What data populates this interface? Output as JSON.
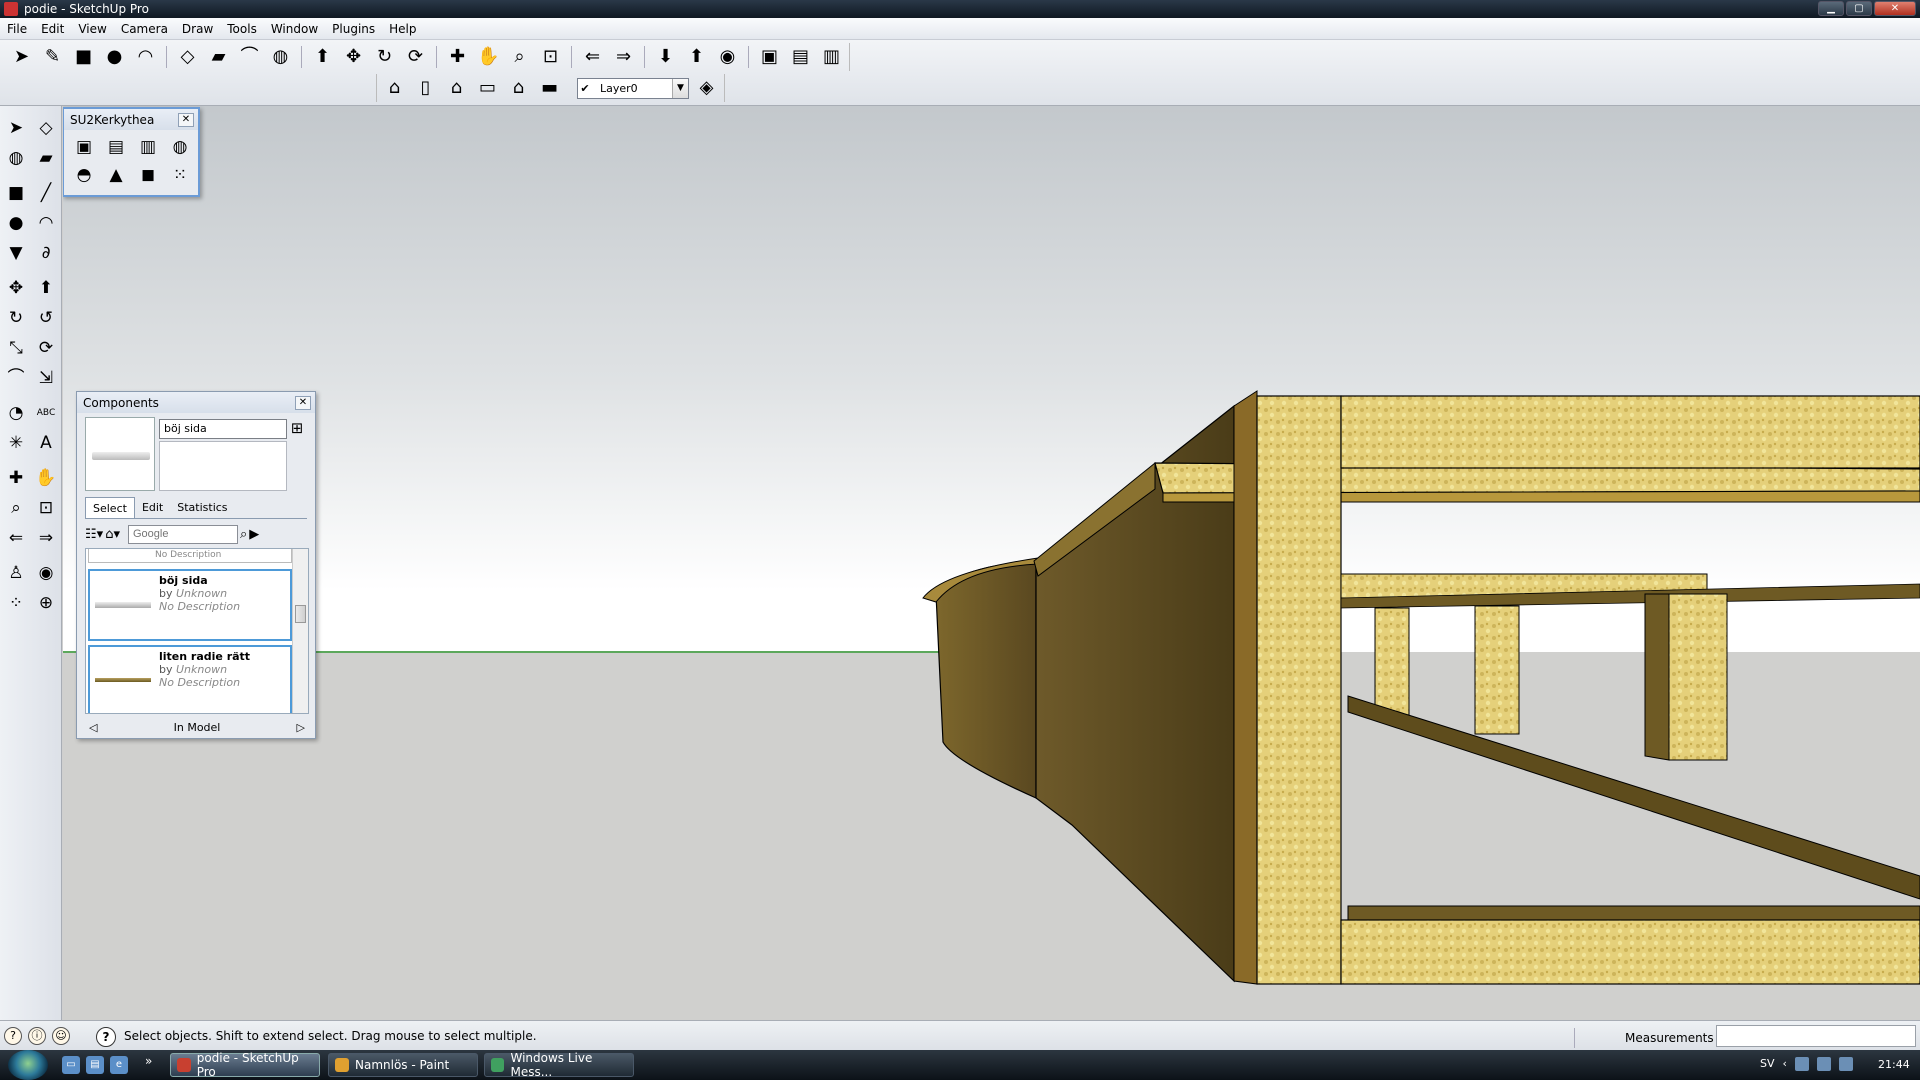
{
  "window": {
    "title": "podie - SketchUp Pro",
    "controls": [
      "minimize",
      "maximize",
      "close"
    ]
  },
  "menu": [
    "File",
    "Edit",
    "View",
    "Camera",
    "Draw",
    "Tools",
    "Window",
    "Plugins",
    "Help"
  ],
  "toolbar1": {
    "tools": [
      {
        "name": "select-icon",
        "glyph": "➤"
      },
      {
        "name": "pencil-icon",
        "glyph": "✎"
      },
      {
        "name": "rectangle-icon",
        "glyph": "■"
      },
      {
        "name": "circle-icon",
        "glyph": "●"
      },
      {
        "name": "arc-icon",
        "glyph": "◠"
      },
      {
        "name": "make-component-icon",
        "glyph": "◇"
      },
      {
        "name": "eraser-icon",
        "glyph": "▰"
      },
      {
        "name": "tape-measure-icon",
        "glyph": "⌒"
      },
      {
        "name": "paint-bucket-icon",
        "glyph": "◍"
      },
      {
        "name": "push-pull-icon",
        "glyph": "⬆"
      },
      {
        "name": "move-icon",
        "glyph": "✥"
      },
      {
        "name": "rotate-icon",
        "glyph": "↻"
      },
      {
        "name": "offset-icon",
        "glyph": "⟳"
      },
      {
        "name": "orbit-icon",
        "glyph": "✚"
      },
      {
        "name": "pan-icon",
        "glyph": "✋"
      },
      {
        "name": "zoom-icon",
        "glyph": "⌕"
      },
      {
        "name": "zoom-extents-icon",
        "glyph": "⊡"
      },
      {
        "name": "previous-view-icon",
        "glyph": "⇐"
      },
      {
        "name": "next-view-icon",
        "glyph": "⇒"
      },
      {
        "name": "get-models-icon",
        "glyph": "⬇"
      },
      {
        "name": "share-model-icon",
        "glyph": "⬆"
      },
      {
        "name": "google-earth-icon",
        "glyph": "◉"
      },
      {
        "name": "get-current-view-icon",
        "glyph": "▣"
      },
      {
        "name": "toggle-terrain-icon",
        "glyph": "▤"
      },
      {
        "name": "place-model-icon",
        "glyph": "▥"
      }
    ]
  },
  "toolbar2": {
    "views": [
      {
        "name": "iso-view-icon",
        "glyph": "⌂"
      },
      {
        "name": "top-view-icon",
        "glyph": "▯"
      },
      {
        "name": "front-view-icon",
        "glyph": "⌂"
      },
      {
        "name": "right-view-icon",
        "glyph": "▭"
      },
      {
        "name": "back-view-icon",
        "glyph": "⌂"
      },
      {
        "name": "left-view-icon",
        "glyph": "▬"
      }
    ],
    "layer": "Layer0",
    "layer_manager_glyph": "◈"
  },
  "left_toolbar": {
    "tools": [
      {
        "name": "select-icon",
        "glyph": "➤"
      },
      {
        "name": "make-component-icon",
        "glyph": "◇"
      },
      {
        "name": "paint-bucket-icon",
        "glyph": "◍"
      },
      {
        "name": "eraser-icon",
        "glyph": "▰"
      },
      {
        "name": "rectangle-icon",
        "glyph": "■"
      },
      {
        "name": "line-icon",
        "glyph": "╱"
      },
      {
        "name": "circle-icon",
        "glyph": "●"
      },
      {
        "name": "arc-icon",
        "glyph": "◠"
      },
      {
        "name": "polygon-icon",
        "glyph": "▼"
      },
      {
        "name": "freehand-icon",
        "glyph": "∂"
      },
      {
        "name": "move-icon",
        "glyph": "✥"
      },
      {
        "name": "push-pull-icon",
        "glyph": "⬆"
      },
      {
        "name": "rotate-icon",
        "glyph": "↻"
      },
      {
        "name": "follow-me-icon",
        "glyph": "↺"
      },
      {
        "name": "scale-icon",
        "glyph": "⤡"
      },
      {
        "name": "offset-icon",
        "glyph": "⟳"
      },
      {
        "name": "tape-measure-icon",
        "glyph": "⌒"
      },
      {
        "name": "dimension-icon",
        "glyph": "⇲"
      },
      {
        "name": "protractor-icon",
        "glyph": "◔"
      },
      {
        "name": "text-icon",
        "glyph": "ABC"
      },
      {
        "name": "axes-icon",
        "glyph": "✳"
      },
      {
        "name": "3d-text-icon",
        "glyph": "A"
      },
      {
        "name": "orbit-icon",
        "glyph": "✚"
      },
      {
        "name": "pan-icon",
        "glyph": "✋"
      },
      {
        "name": "zoom-icon",
        "glyph": "⌕"
      },
      {
        "name": "zoom-window-icon",
        "glyph": "⊡"
      },
      {
        "name": "previous-view-icon",
        "glyph": "⇐"
      },
      {
        "name": "zoom-extents-icon",
        "glyph": "⇒"
      },
      {
        "name": "position-camera-icon",
        "glyph": "♙"
      },
      {
        "name": "look-around-icon",
        "glyph": "◉"
      },
      {
        "name": "walk-icon",
        "glyph": "⁘"
      },
      {
        "name": "section-plane-icon",
        "glyph": "⊕"
      }
    ]
  },
  "su2kerkythea": {
    "title": "SU2Kerkythea",
    "icons": [
      {
        "name": "export-icon",
        "glyph": "▣"
      },
      {
        "name": "scene-icon",
        "glyph": "▤"
      },
      {
        "name": "animation-icon",
        "glyph": "▥"
      },
      {
        "name": "render-icon",
        "glyph": "◍"
      },
      {
        "name": "lamp-icon",
        "glyph": "◓"
      },
      {
        "name": "light-icon",
        "glyph": "▲"
      },
      {
        "name": "material-icon",
        "glyph": "◼"
      },
      {
        "name": "palette-icon",
        "glyph": "⁙"
      }
    ]
  },
  "components": {
    "title": "Components",
    "selected_name": "böj sida",
    "tabs": [
      "Select",
      "Edit",
      "Statistics"
    ],
    "active_tab": "Select",
    "search_placeholder": "Google",
    "items": [
      {
        "name": "böj sida",
        "by_label": "by",
        "author": "Unknown",
        "description": "No Description"
      },
      {
        "name": "liten radie rätt",
        "by_label": "by",
        "author": "Unknown",
        "description": "No Description"
      }
    ],
    "partial_item_description": "No Description",
    "footer": "In Model"
  },
  "status": {
    "message": "Select objects. Shift to extend select. Drag mouse to select multiple.",
    "measurements_label": "Measurements",
    "measurements_value": ""
  },
  "taskbar": {
    "tasks": [
      {
        "label": "podie - SketchUp Pro",
        "active": true,
        "color": "#c84030"
      },
      {
        "label": "Namnlös - Paint",
        "active": false,
        "color": "#e0a030"
      },
      {
        "label": "Windows Live Mess...",
        "active": false,
        "color": "#40a060"
      }
    ],
    "language": "SV",
    "time": "21:44"
  }
}
